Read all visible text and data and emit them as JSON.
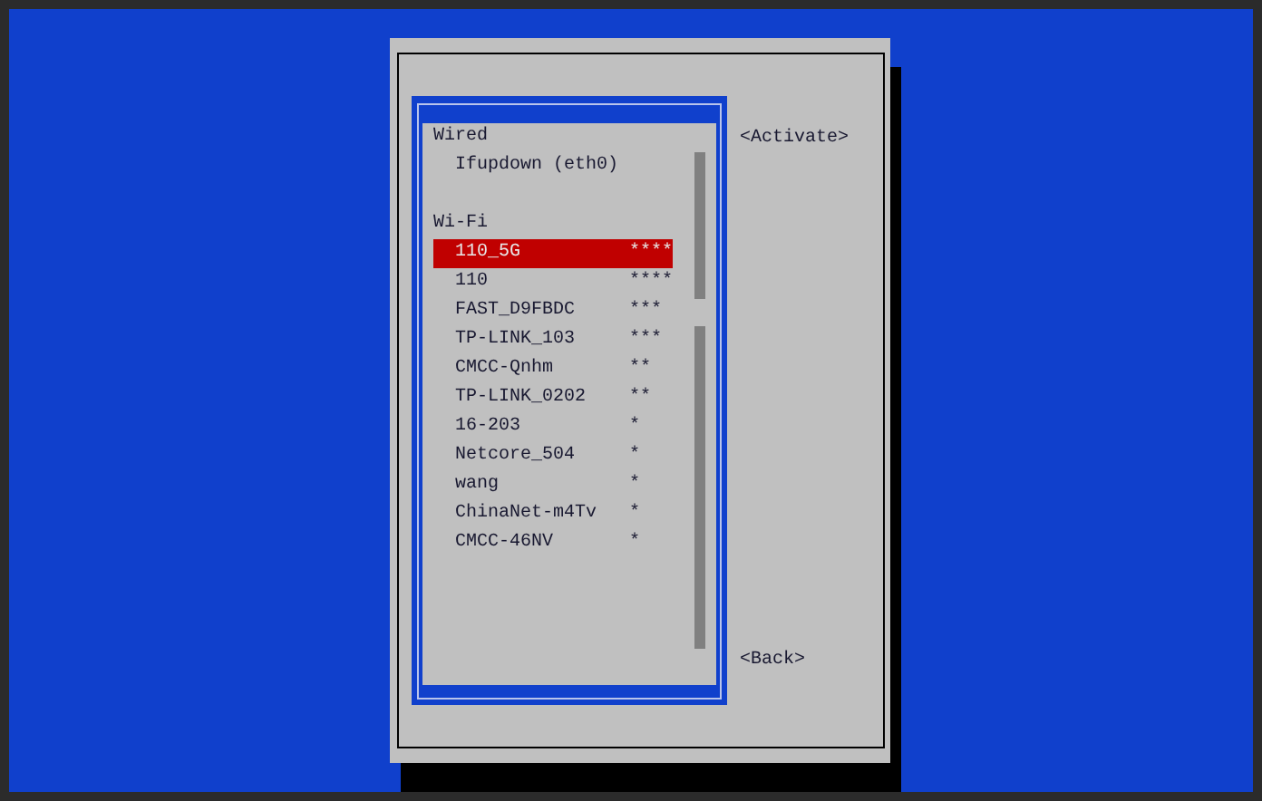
{
  "sections": [
    {
      "title": "Wired",
      "items": [
        {
          "name": "Ifupdown (eth0)",
          "selected": false
        }
      ]
    },
    {
      "title": "Wi-Fi",
      "items": [
        {
          "name": "110_5G",
          "signal": "****",
          "selected": true
        },
        {
          "name": "110",
          "signal": "****",
          "selected": false
        },
        {
          "name": "FAST_D9FBDC",
          "signal": "***",
          "selected": false
        },
        {
          "name": "TP-LINK_103",
          "signal": "***",
          "selected": false
        },
        {
          "name": "CMCC-Qnhm",
          "signal": "**",
          "selected": false
        },
        {
          "name": "TP-LINK_0202",
          "signal": "**",
          "selected": false
        },
        {
          "name": "16-203",
          "signal": "*",
          "selected": false
        },
        {
          "name": "Netcore_504",
          "signal": "*",
          "selected": false
        },
        {
          "name": "wang",
          "signal": "*",
          "selected": false
        },
        {
          "name": "ChinaNet-m4Tv",
          "signal": "*",
          "selected": false
        },
        {
          "name": "CMCC-46NV",
          "signal": "*",
          "selected": false
        }
      ]
    }
  ],
  "buttons": [
    "<Activate>",
    "<Back>"
  ]
}
